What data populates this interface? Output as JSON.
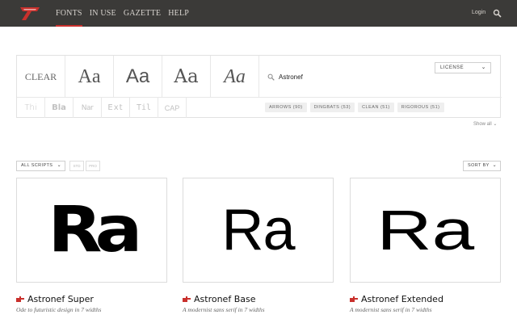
{
  "header": {
    "nav": [
      "FONTS",
      "IN USE",
      "GAZETTE",
      "HELP"
    ],
    "active_nav": "FONTS",
    "login_label": "Login",
    "accent_color": "#c9302c",
    "bar_color": "#3b3a38"
  },
  "filters": {
    "styles": [
      "CLEAR",
      "Aa",
      "Aa",
      "Aa",
      "Aa"
    ],
    "search_value": "Astronef",
    "license_label": "LICENSE",
    "categories": [
      "Thi",
      "Bla",
      "Nar",
      "Ext",
      "Til",
      "CAP"
    ],
    "tags": [
      "ARROWS (90)",
      "DINGBATS (53)",
      "CLEAN (51)",
      "RIGOROUS (51)"
    ],
    "show_all_label": "Show all"
  },
  "controls": {
    "scripts_label": "ALL SCRIPTS",
    "format_buttons": [
      "STD",
      "PRO"
    ],
    "sort_label": "SORT BY"
  },
  "cards": [
    {
      "preview": "Ra",
      "name": "Astronef Super",
      "description": "Ode to futuristic design in 7 widths"
    },
    {
      "preview": "Ra",
      "name": "Astronef Base",
      "description": "A modernist sans serif in 7 widths"
    },
    {
      "preview": "Ra",
      "name": "Astronef Extended",
      "description": "A modernist sans serif in 7 widths"
    }
  ],
  "icons": {
    "logo": "foundry-logo-icon",
    "search": "search-icon",
    "hand": "pointing-hand-icon",
    "dropdown": "chevron-down-icon"
  }
}
